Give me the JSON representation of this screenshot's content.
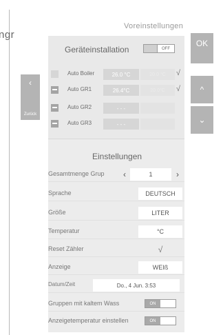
{
  "clipped_text": "ngr",
  "screen_title": "Voreinstellungen",
  "buttons": {
    "ok": "OK",
    "back_arrow": "‹",
    "back_label": "Zurück",
    "up": "^",
    "down": "⌄"
  },
  "installation": {
    "title": "Geräteinstallation",
    "toggle": "OFF"
  },
  "devices": [
    {
      "name": "Auto Boiler",
      "temp": "26.0 °C",
      "temp2": "20.0 °C",
      "checked": false,
      "mark": "√"
    },
    {
      "name": "Auto GR1",
      "temp": "26.4°C",
      "temp2": "20.0°C",
      "checked": true,
      "mark": "√"
    },
    {
      "name": "Auto GR2",
      "temp": "- - -",
      "temp2": "",
      "checked": true,
      "mark": ""
    },
    {
      "name": "Auto GR3",
      "temp": "- - -",
      "temp2": "",
      "checked": true,
      "mark": ""
    }
  ],
  "settings": {
    "title": "Einstellungen",
    "group_total": {
      "label": "Gesamtmenge Grup",
      "prev": "‹",
      "value": "1",
      "next": "›"
    },
    "language": {
      "label": "Sprache",
      "value": "DEUTSCH"
    },
    "size": {
      "label": "Größe",
      "value": "LITER"
    },
    "temperature": {
      "label": "Temperatur",
      "value": "°C"
    },
    "reset": {
      "label": "Reset Zähler",
      "value": "√"
    },
    "display": {
      "label": "Anzeige",
      "value": "WEIß"
    },
    "datetime": {
      "label": "Datum/Zeit",
      "value": "Do., 4 Jun. 3:53"
    },
    "cold_water": {
      "label": "Gruppen mit kaltem Wass",
      "toggle": "ON"
    },
    "display_temp": {
      "label": "Anzeigetemperatur einstellen",
      "toggle": "ON"
    }
  }
}
